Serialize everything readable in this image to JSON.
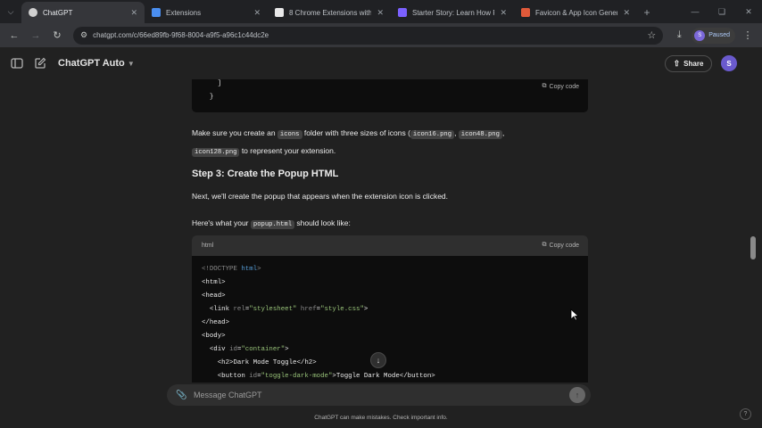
{
  "browser": {
    "tabs": [
      {
        "label": "ChatGPT",
        "favicon": "chatgpt-favicon",
        "active": true,
        "color": "#d0d0d0"
      },
      {
        "label": "Extensions",
        "favicon": "puzzle-icon",
        "active": false,
        "color": "#4a8ef0"
      },
      {
        "label": "8 Chrome Extensions with Ir",
        "favicon": "page-favicon",
        "active": false,
        "color": "#e8e8e8"
      },
      {
        "label": "Starter Story: Learn How Pe",
        "favicon": "starter-story-favicon",
        "active": false,
        "color": "#7b61ff"
      },
      {
        "label": "Favicon & App Icon Generat",
        "favicon": "favicon-generator-favicon",
        "active": false,
        "color": "#e05a3a"
      }
    ],
    "url": "chatgpt.com/c/66ed89fb-9f68-8004-a9f5-a96c1c44dc2e",
    "profile_initial": "S",
    "profile_status": "Paused"
  },
  "app": {
    "title": "ChatGPT Auto",
    "share_label": "Share",
    "user_initial": "S"
  },
  "content": {
    "code_block_1": {
      "lines": [
        "    ]",
        "  }"
      ],
      "copy_label": "Copy code"
    },
    "para_icons": {
      "t1": "Make sure you create an ",
      "c1": "icons",
      "t2": " folder with three sizes of icons (",
      "c2": "icon16.png",
      "t3": ", ",
      "c3": "icon48.png",
      "t4": ",",
      "c4": "icon128.png",
      "t5": " to represent your extension."
    },
    "step3_heading": "Step 3: Create the Popup HTML",
    "para_next": "Next, we'll create the popup that appears when the extension icon is clicked.",
    "para_popup": {
      "t1": "Here's what your ",
      "c1": "popup.html",
      "t2": " should look like:"
    },
    "code_block_2": {
      "language": "html",
      "copy_label": "Copy code"
    }
  },
  "composer": {
    "placeholder": "Message ChatGPT"
  },
  "footer": {
    "disclaimer": "ChatGPT can make mistakes. Check important info.",
    "help": "?"
  }
}
